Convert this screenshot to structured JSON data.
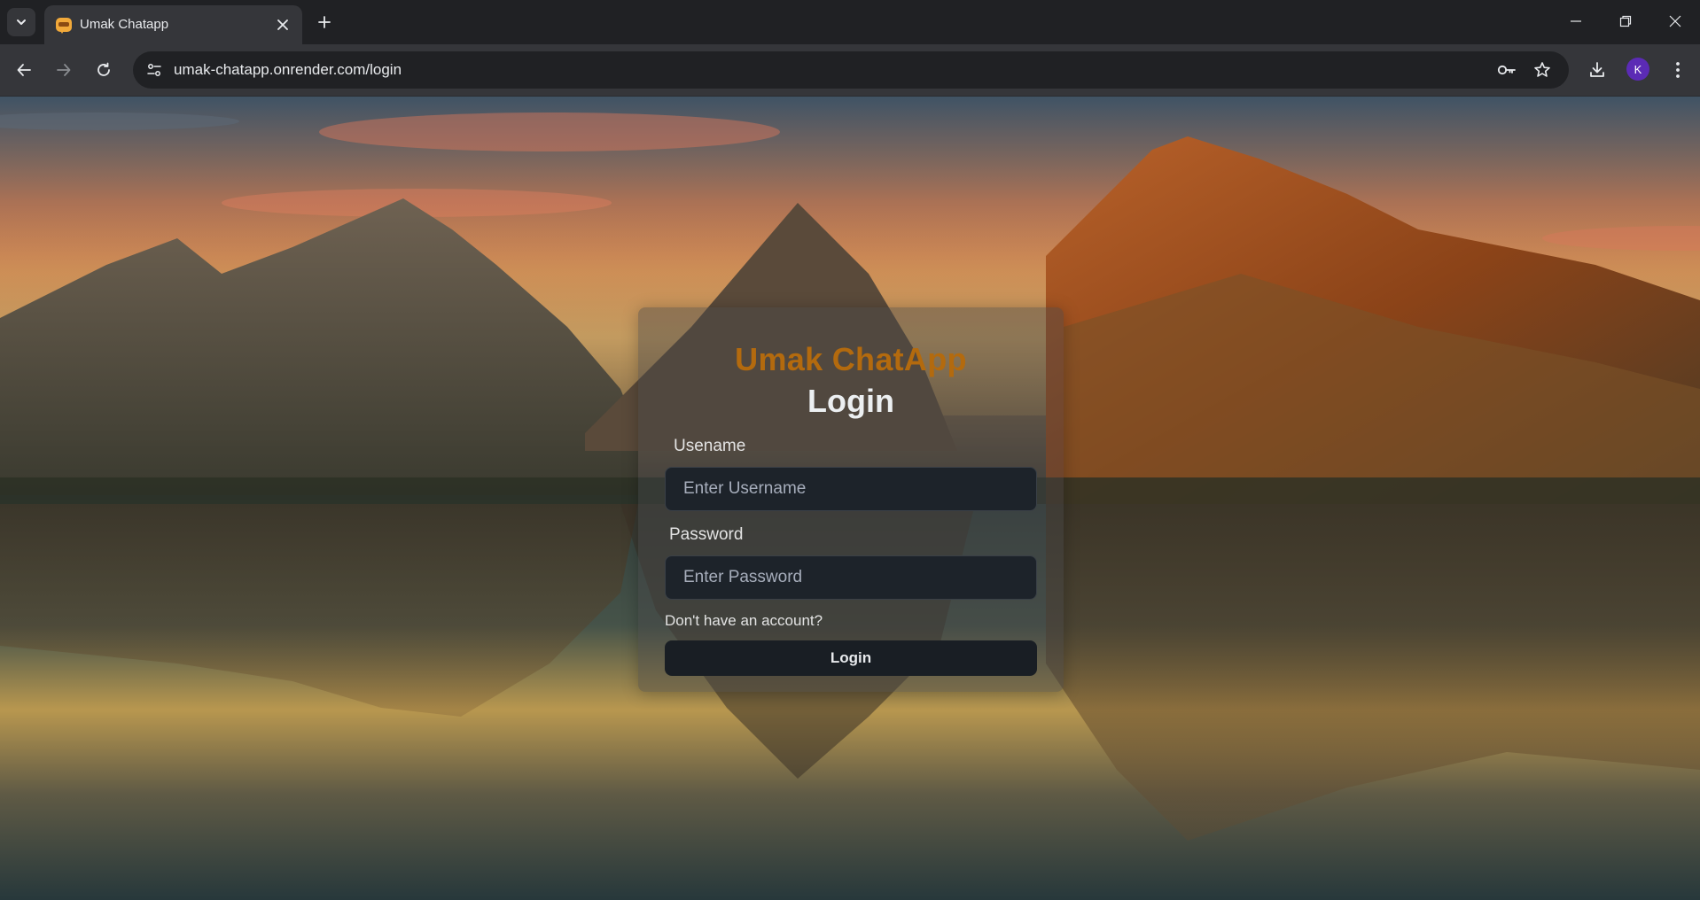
{
  "browser": {
    "tab": {
      "title": "Umak Chatapp",
      "favicon": "chat-bubble-icon"
    },
    "address_bar": {
      "url": "umak-chatapp.onrender.com/login"
    },
    "profile_initial": "K",
    "icons": {
      "tab_search": "chevron-down-icon",
      "tab_close": "close-icon",
      "new_tab": "plus-icon",
      "minimize": "minimize-icon",
      "restore": "restore-icon",
      "close_window": "close-icon",
      "back": "arrow-left-icon",
      "forward": "arrow-right-icon",
      "reload": "reload-icon",
      "site_info": "tune-icon",
      "password_key": "key-icon",
      "bookmark": "star-icon",
      "downloads": "download-icon",
      "menu": "more-vert-icon"
    }
  },
  "login": {
    "brand": "Umak ChatApp",
    "heading": "Login",
    "username_label": "Usename",
    "username_placeholder": "Enter Username",
    "password_label": "Password",
    "password_placeholder": "Enter Password",
    "signup_link": "Don't have an account?",
    "submit_label": "Login"
  },
  "colors": {
    "brand": "#b36a0e",
    "profile_avatar": "#5b2bb5",
    "button_bg": "#191e24",
    "input_bg": "#1d232a"
  }
}
